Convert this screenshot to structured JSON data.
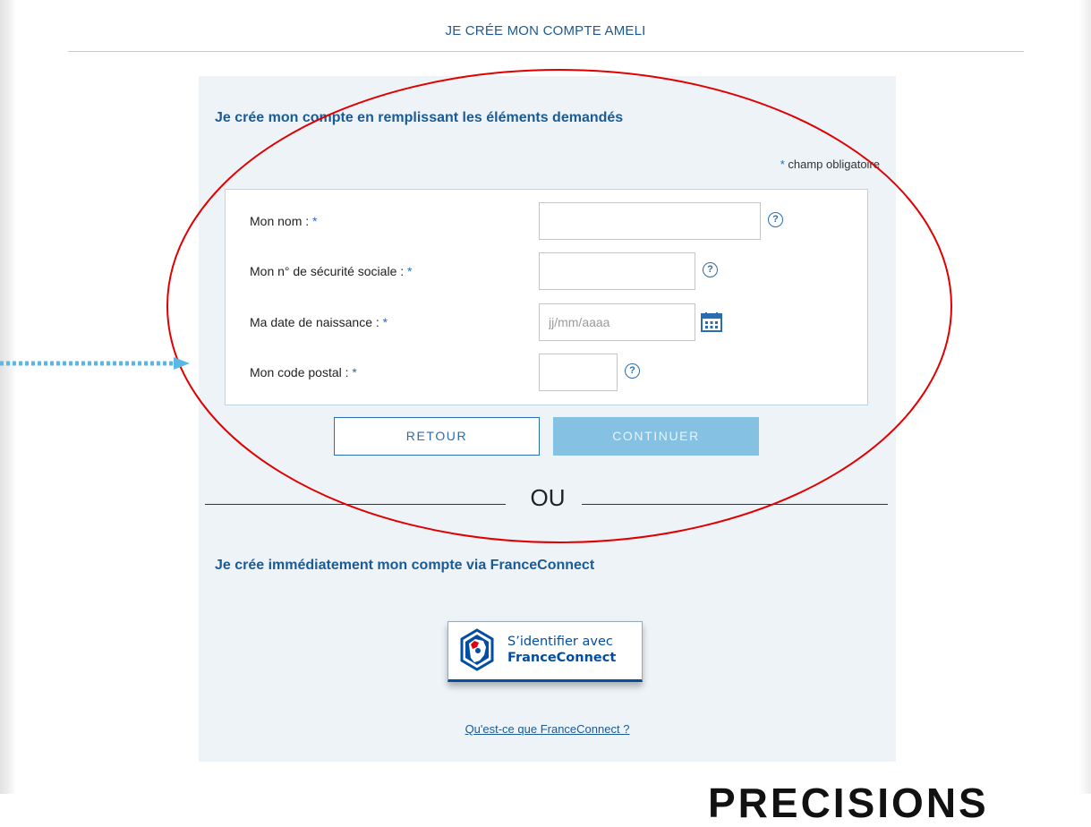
{
  "page": {
    "title": "JE CRÉE MON COMPTE AMELI"
  },
  "form": {
    "heading": "Je crée mon compte en remplissant les éléments demandés",
    "required_star": "*",
    "required_note": "champ obligatoire",
    "fields": [
      {
        "label": "Mon nom :",
        "value": "",
        "placeholder": "",
        "help_icon": "question-circle-icon"
      },
      {
        "label": "Mon n° de sécurité sociale :",
        "value": "",
        "placeholder": "",
        "help_icon": "question-circle-icon"
      },
      {
        "label": "Ma date de naissance :",
        "value": "",
        "placeholder": "jj/mm/aaaa",
        "icon": "calendar-icon"
      },
      {
        "label": "Mon code postal :",
        "value": "",
        "placeholder": "",
        "help_icon": "question-circle-icon"
      }
    ],
    "back_label": "RETOUR",
    "continue_label": "CONTINUER"
  },
  "separator": {
    "text": "OU"
  },
  "franceconnect": {
    "heading": "Je crée immédiatement mon compte via FranceConnect",
    "button_line1": "S’identifier avec",
    "button_line2": "FranceConnect",
    "link": "Qu'est-ce que FranceConnect ?"
  },
  "overlay": {
    "text": "PRECISIONS"
  },
  "colors": {
    "brand_blue": "#1a5b96",
    "accent_blue": "#2a6db0",
    "disabled_button": "#84c1e2",
    "card_background": "#edf3f7",
    "annotation_red": "#e00000",
    "annotation_arrow": "#5bb8e6",
    "franceconnect_blue": "#034ea2"
  }
}
